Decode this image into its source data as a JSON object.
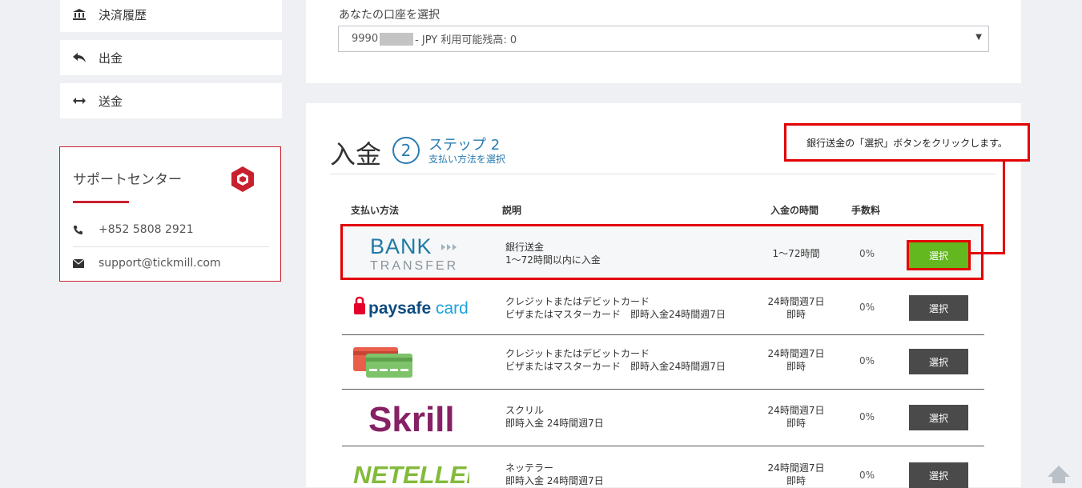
{
  "sidebar": {
    "items": [
      {
        "label": "決済履歴",
        "icon": "bank-icon"
      },
      {
        "label": "出金",
        "icon": "reply-arrow-icon"
      },
      {
        "label": "送金",
        "icon": "left-right-arrow-icon"
      }
    ],
    "support": {
      "title": "サポートセンター",
      "phone": "+852 5808 2921",
      "email": "support@tickmill.com"
    }
  },
  "account": {
    "label": "あなたの口座を選択",
    "prefix": "9990",
    "suffix": "- JPY 利用可能残高: 0"
  },
  "deposit": {
    "heading": "入金",
    "step_number": "2",
    "step_title": "ステップ 2",
    "step_subtitle": "支払い方法を選択",
    "columns": {
      "method": "支払い方法",
      "description": "説明",
      "time": "入金の時間",
      "fee": "手数料"
    },
    "methods": [
      {
        "logo": "BANK TRANSFER",
        "desc1": "銀行送金",
        "desc2": "1〜72時間以内に入金",
        "time1": "1〜72時間",
        "time2": "",
        "fee": "0%",
        "button": "選択"
      },
      {
        "logo": "paysafecard",
        "desc1": "クレジットまたはデビットカード",
        "desc2": "ビザまたはマスターカード　即時入金24時間週7日",
        "time1": "24時間週7日",
        "time2": "即時",
        "fee": "0%",
        "button": "選択"
      },
      {
        "logo": "credit-cards",
        "desc1": "クレジットまたはデビットカード",
        "desc2": "ビザまたはマスターカード　即時入金24時間週7日",
        "time1": "24時間週7日",
        "time2": "即時",
        "fee": "0%",
        "button": "選択"
      },
      {
        "logo": "Skrill",
        "desc1": "スクリル",
        "desc2": "即時入金 24時間週7日",
        "time1": "24時間週7日",
        "time2": "即時",
        "fee": "0%",
        "button": "選択"
      },
      {
        "logo": "NETELLER",
        "desc1": "ネッテラー",
        "desc2": "即時入金 24時間週7日",
        "time1": "24時間週7日",
        "time2": "即時",
        "fee": "0%",
        "button": "選択"
      }
    ]
  },
  "annotation": {
    "text": "銀行送金の「選択」ボタンをクリックします。"
  },
  "colors": {
    "accent": "#2a7bb0",
    "highlight": "#e30000",
    "select_green": "#62b81e",
    "brand_red": "#c8202f"
  }
}
